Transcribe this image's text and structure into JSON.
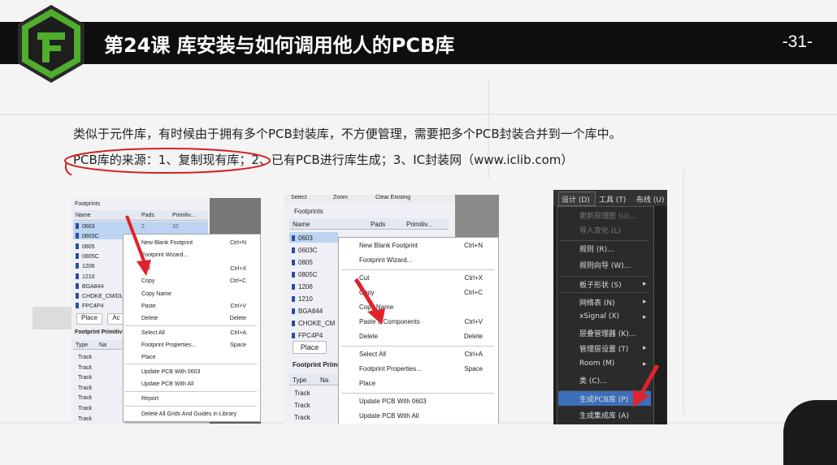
{
  "slide": {
    "title": "第24课 库安装与如何调用他人的PCB库",
    "page_number": "-31-",
    "line1": "类似于元件库，有时候由于拥有多个PCB封装库，不方便管理，需要把多个PCB封装合并到一个库中。",
    "line2": "PCB库的来源：1、复制现有库；2、已有PCB进行库生成；3、IC封装网（www.iclib.com）"
  },
  "shot1": {
    "panel_title": "Footprints",
    "col_name": "Name",
    "col_pads": "Pads",
    "col_prim": "Primitiv...",
    "rows": [
      "0603",
      "0603C",
      "0805",
      "0805C",
      "1206",
      "1210",
      "BGA844",
      "CHOKE_CM/DL",
      "FPC4P4"
    ],
    "first_row_pads": "2",
    "first_row_prim": "10",
    "place_btn": "Place",
    "add_btn": "Ac",
    "prim_title": "Footprint Primitiv",
    "prim_col_type": "Type",
    "prim_col_name": "Na",
    "prim_rows": [
      "Track",
      "Track",
      "Track",
      "Track",
      "Track",
      "Track",
      "Track"
    ],
    "menu": [
      {
        "label": "New Blank Footprint",
        "key": "Ctrl+N"
      },
      {
        "label": "Footprint Wizard...",
        "key": ""
      },
      {
        "label": "Cut",
        "key": "Ctrl+X"
      },
      {
        "label": "Copy",
        "key": "Ctrl+C"
      },
      {
        "label": "Copy Name",
        "key": ""
      },
      {
        "label": "Paste",
        "key": "Ctrl+V"
      },
      {
        "label": "Delete",
        "key": "Delete"
      },
      {
        "label": "Select All",
        "key": "Ctrl+A"
      },
      {
        "label": "Footprint Properties...",
        "key": "Space"
      },
      {
        "label": "Place",
        "key": ""
      },
      {
        "label": "Update PCB With 0603",
        "key": ""
      },
      {
        "label": "Update PCB With All",
        "key": ""
      },
      {
        "label": "Report",
        "key": ""
      },
      {
        "label": "Delete All Grids And Guides in Library",
        "key": ""
      }
    ]
  },
  "shot2": {
    "toolbar": [
      "Select",
      "Zoom",
      "Clear Existing"
    ],
    "panel_title": "Footprints",
    "col_name": "Name",
    "col_pads": "Pads",
    "col_prim": "Primitiv...",
    "rows": [
      "0603",
      "0603C",
      "0805",
      "0805C",
      "1206",
      "1210",
      "BGA844",
      "CHOKE_CM",
      "FPC4P4"
    ],
    "place_btn": "Place",
    "prim_title": "Footprint Primi",
    "prim_col_type": "Type",
    "prim_col_name": "Na",
    "prim_rows": [
      "Track",
      "Track",
      "Track"
    ],
    "menu": [
      {
        "label": "New Blank Footprint",
        "key": "Ctrl+N"
      },
      {
        "label": "Footprint Wizard...",
        "key": ""
      },
      {
        "label": "Cut",
        "key": "Ctrl+X"
      },
      {
        "label": "Copy",
        "key": "Ctrl+C"
      },
      {
        "label": "Copy Name",
        "key": ""
      },
      {
        "label": "Paste 5 Components",
        "key": "Ctrl+V"
      },
      {
        "label": "Delete",
        "key": "Delete"
      },
      {
        "label": "Select All",
        "key": "Ctrl+A"
      },
      {
        "label": "Footprint Properties...",
        "key": "Space"
      },
      {
        "label": "Place",
        "key": ""
      },
      {
        "label": "Update PCB With 0603",
        "key": ""
      },
      {
        "label": "Update PCB With All",
        "key": ""
      }
    ]
  },
  "shot3": {
    "menubar": [
      "设计 (D)",
      "工具 (T)",
      "布线 (U)"
    ],
    "items": [
      "更新原理图 (U)...",
      "导入变化 (L)",
      "规则 (R)...",
      "规则向导 (W)...",
      "板子形状 (S)",
      "网络表 (N)",
      "xSignal (X)",
      "层叠管理器 (K)...",
      "管理层设置 (T)",
      "Room (M)",
      "类 (C)...",
      "生成PCB库 (P)",
      "生成集成库 (A)"
    ]
  },
  "colors": {
    "header": "#0e0e0e",
    "logo_green": "#4fae2c",
    "menu_dark": "#2b2b2b",
    "highlight": "#3d6fb8",
    "arrow_red": "#e0222a"
  }
}
